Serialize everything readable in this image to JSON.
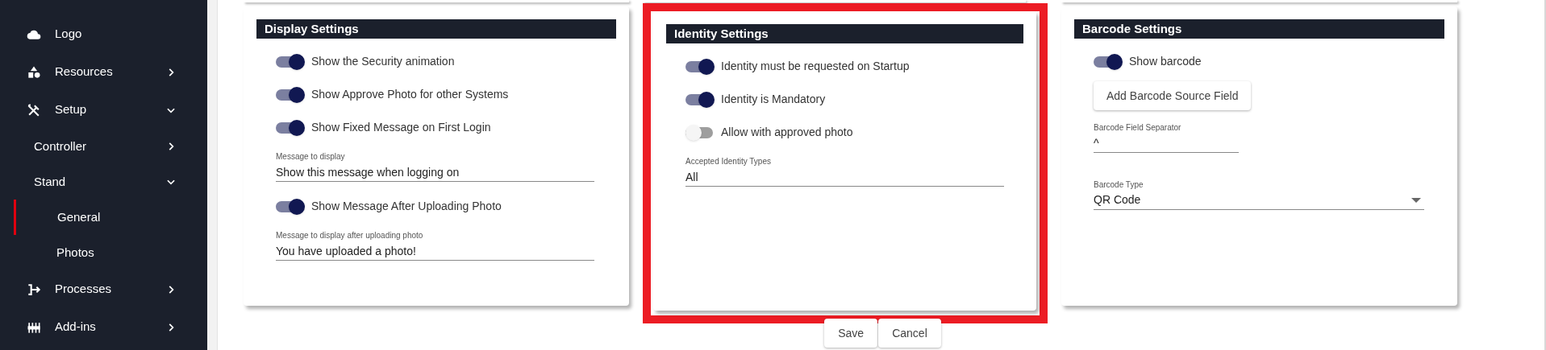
{
  "sidebar": {
    "items": [
      {
        "label": "Logo"
      },
      {
        "label": "Resources",
        "expanded": false
      },
      {
        "label": "Setup",
        "expanded": true,
        "children": [
          {
            "label": "Controller",
            "expanded": false
          },
          {
            "label": "Stand",
            "expanded": true,
            "children": [
              {
                "label": "General",
                "selected": true
              },
              {
                "label": "Photos",
                "selected": false
              }
            ]
          }
        ]
      },
      {
        "label": "Processes",
        "expanded": false
      },
      {
        "label": "Add-ins",
        "expanded": false
      }
    ]
  },
  "cards": [
    {
      "title": "Display Settings",
      "highlighted": false,
      "items": [
        {
          "kind": "toggle",
          "label": "Show the Security animation",
          "on": true
        },
        {
          "kind": "toggle",
          "label": "Show Approve Photo for other Systems",
          "on": true
        },
        {
          "kind": "toggle",
          "label": "Show Fixed Message on First Login",
          "on": true
        },
        {
          "kind": "field",
          "label": "Message to display",
          "value": "Show this message when logging on"
        },
        {
          "kind": "toggle",
          "label": "Show Message After Uploading Photo",
          "on": true
        },
        {
          "kind": "field",
          "label": "Message to display after uploading photo",
          "value": "You have uploaded a photo!"
        }
      ]
    },
    {
      "title": "Identity Settings",
      "highlighted": true,
      "items": [
        {
          "kind": "toggle",
          "label": "Identity must be requested on Startup",
          "on": true
        },
        {
          "kind": "toggle",
          "label": "Identity is Mandatory",
          "on": true
        },
        {
          "kind": "toggle",
          "label": "Allow with approved photo",
          "on": false
        },
        {
          "kind": "field",
          "label": "Accepted Identity Types",
          "value": "All"
        }
      ]
    },
    {
      "title": "Barcode Settings",
      "highlighted": false,
      "items": [
        {
          "kind": "toggle",
          "label": "Show barcode",
          "on": true
        },
        {
          "kind": "button",
          "label": "Add Barcode Source Field"
        },
        {
          "kind": "short-field",
          "label": "Barcode Field Separator",
          "value": "^"
        },
        {
          "kind": "select",
          "label": "Barcode Type",
          "value": "QR Code"
        }
      ]
    }
  ],
  "buttons": [
    "Save",
    "Cancel"
  ]
}
